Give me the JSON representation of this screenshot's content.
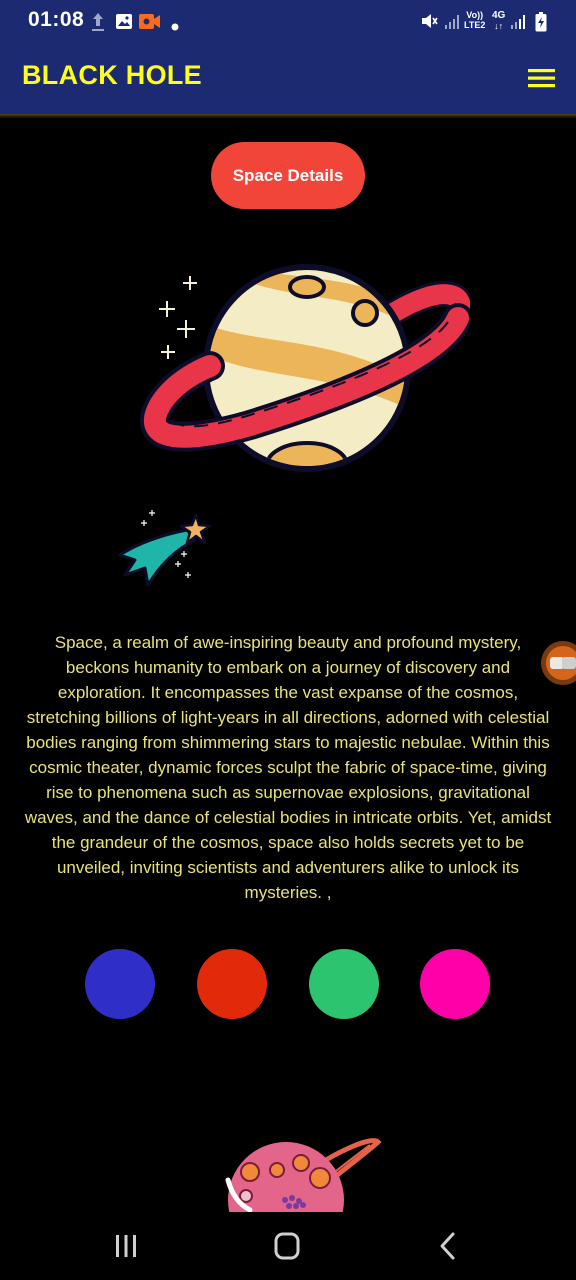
{
  "status_bar": {
    "time": "01:08",
    "network_label_1": "Vo))",
    "network_label_2": "LTE2",
    "network_label_3": "4G"
  },
  "app_bar": {
    "title": "BLACK HOLE",
    "title_color": "#ffff1a",
    "background_color": "#1c2a72",
    "menu_icon": "hamburger-menu-icon"
  },
  "details_button": {
    "label": "Space Details",
    "color": "#f2453a"
  },
  "description": "Space, a realm of awe-inspiring beauty and profound mystery, beckons humanity to embark on a journey of discovery and exploration. It encompasses the vast expanse of the cosmos, stretching billions of light-years in all directions, adorned with celestial bodies ranging from shimmering stars to majestic nebulae. Within this cosmic theater, dynamic forces sculpt the fabric of space-time, giving rise to phenomena such as supernovae explosions, gravitational waves, and the dance of celestial bodies in intricate orbits. Yet, amidst the grandeur of the cosmos, space also holds secrets yet to be unveiled, inviting scientists and adventurers alike to unlock its mysteries. ,",
  "description_color": "#e8e27a",
  "color_options": [
    "#2f2fc8",
    "#e12a0a",
    "#2cc46e",
    "#ff00a8"
  ],
  "nav_bar": {
    "icons": [
      "recent-apps-icon",
      "home-icon",
      "back-icon"
    ]
  }
}
